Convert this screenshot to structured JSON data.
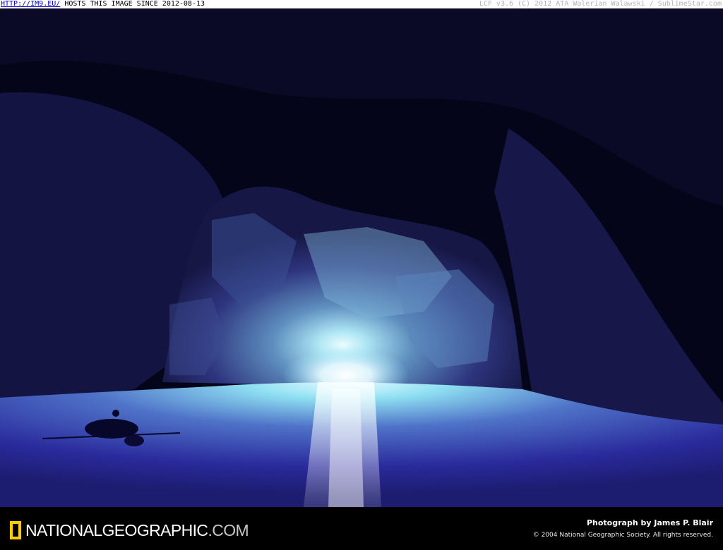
{
  "top_bar": {
    "link": "HTTP://IM9.EU/",
    "tagline": "HOSTS THIS IMAGE SINCE 2012-08-13",
    "right_text": "LCF v3.6 (C) 2012 ATA Walerian Walawski / SublimeStar.com"
  },
  "photo": {
    "subject": "sea-cave-interior",
    "colors": {
      "cave_dark": "#05051a",
      "rock": "#2a2a78",
      "water": "#3a3ab8",
      "light": "#c8f4ff"
    }
  },
  "footer": {
    "logo_text": "NATIONALGEOGRAPHIC",
    "logo_suffix": ".COM",
    "logo_color": "#ffce00",
    "credit": "Photograph by James P. Blair",
    "copyright": "© 2004 National Geographic Society. All rights reserved."
  }
}
